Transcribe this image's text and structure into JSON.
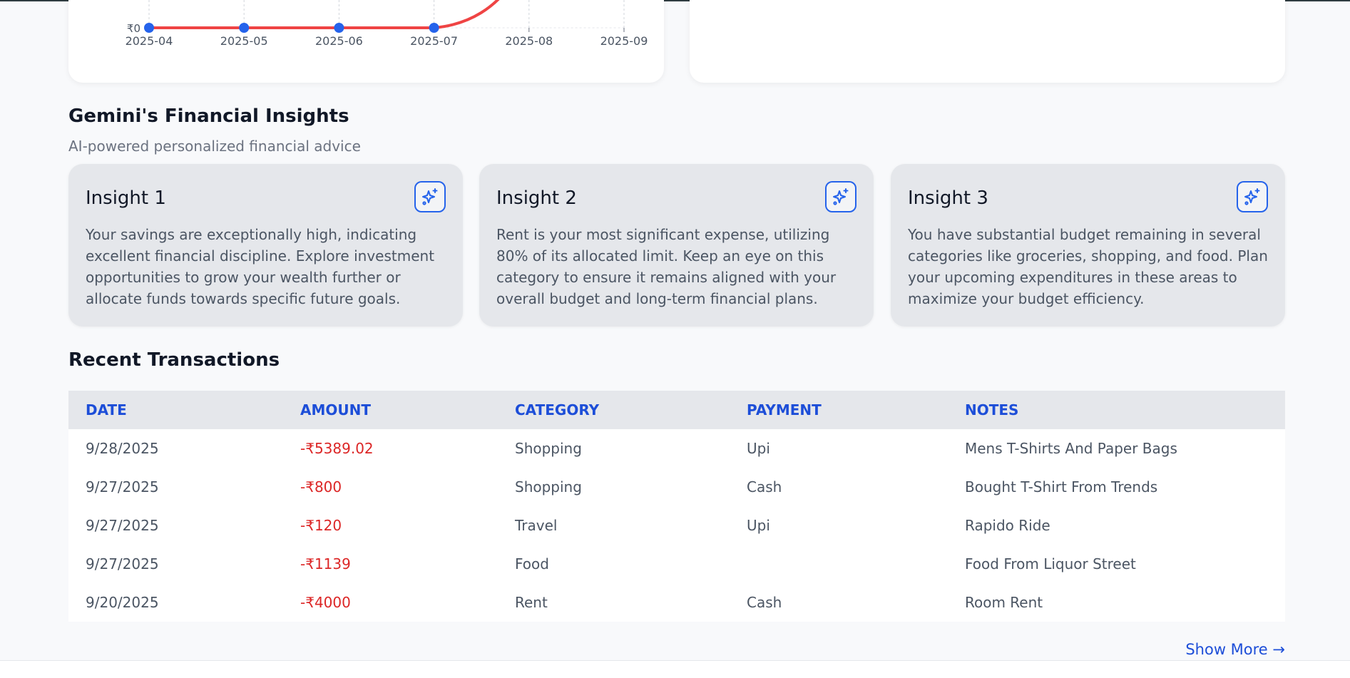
{
  "chart_data": {
    "type": "line",
    "x": [
      "2025-04",
      "2025-05",
      "2025-06",
      "2025-07",
      "2025-08",
      "2025-09"
    ],
    "y_tick_label": "₹0",
    "series": [
      {
        "values": [
          0,
          0,
          0,
          0,
          null,
          null
        ],
        "color": "#ef4444",
        "marker_color": "#2563eb"
      }
    ],
    "trend_after_last_point": "rising steeply (curve continues above visible area toward 2025-08)",
    "grid": true
  },
  "insights": {
    "title": "Gemini's Financial Insights",
    "subtitle": "AI-powered personalized financial advice",
    "icon": "sparkles-icon",
    "accent": "#2563eb",
    "items": [
      {
        "title": "Insight 1",
        "text": "Your savings are exceptionally high, indicating excellent financial discipline. Explore investment opportunities to grow your wealth further or allocate funds towards specific future goals."
      },
      {
        "title": "Insight 2",
        "text": "Rent is your most significant expense, utilizing 80% of its allocated limit. Keep an eye on this category to ensure it remains aligned with your overall budget and long-term financial plans."
      },
      {
        "title": "Insight 3",
        "text": "You have substantial budget remaining in several categories like groceries, shopping, and food. Plan your upcoming expenditures in these areas to maximize your budget efficiency."
      }
    ]
  },
  "transactions": {
    "title": "Recent Transactions",
    "columns": [
      "DATE",
      "AMOUNT",
      "CATEGORY",
      "PAYMENT",
      "NOTES"
    ],
    "rows": [
      {
        "date": "9/28/2025",
        "amount": "-₹5389.02",
        "category": "Shopping",
        "payment": "Upi",
        "notes": "Mens T-Shirts And Paper Bags"
      },
      {
        "date": "9/27/2025",
        "amount": "-₹800",
        "category": "Shopping",
        "payment": "Cash",
        "notes": "Bought T-Shirt From Trends"
      },
      {
        "date": "9/27/2025",
        "amount": "-₹120",
        "category": "Travel",
        "payment": "Upi",
        "notes": "Rapido Ride"
      },
      {
        "date": "9/27/2025",
        "amount": "-₹1139",
        "category": "Food",
        "payment": "",
        "notes": "Food From Liquor Street"
      },
      {
        "date": "9/20/2025",
        "amount": "-₹4000",
        "category": "Rent",
        "payment": "Cash",
        "notes": "Room Rent"
      }
    ],
    "amount_color": "#dc2626",
    "header_color": "#1d4ed8",
    "show_more_label": "Show More →"
  }
}
